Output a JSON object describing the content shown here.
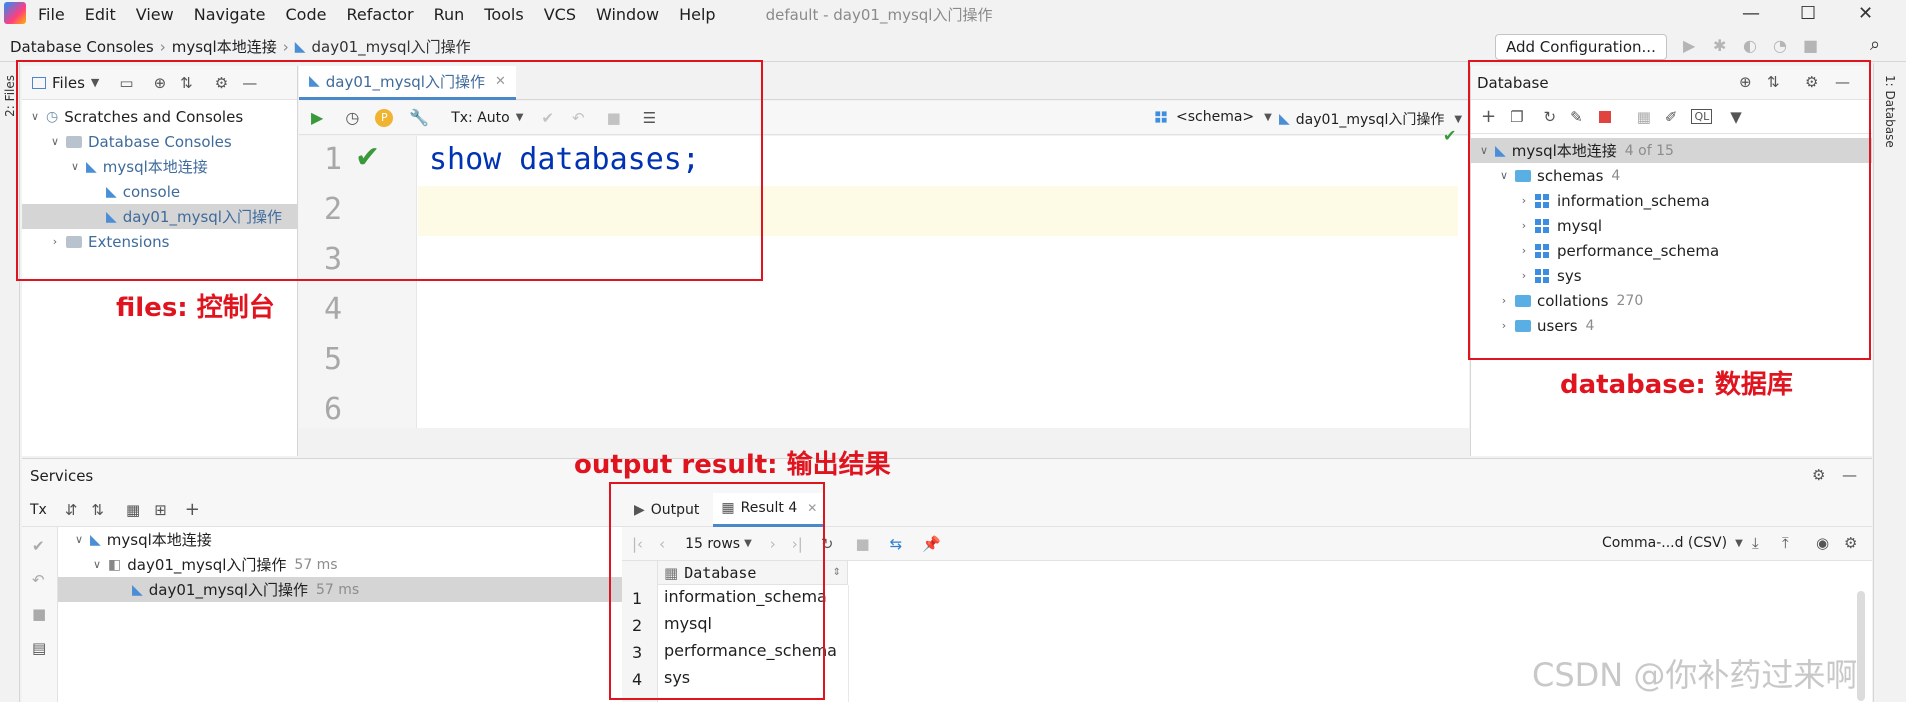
{
  "menu": [
    "File",
    "Edit",
    "View",
    "Navigate",
    "Code",
    "Refactor",
    "Run",
    "Tools",
    "VCS",
    "Window",
    "Help"
  ],
  "window_title": "default - day01_mysql入门操作",
  "breadcrumb": [
    "Database Consoles",
    "mysql本地连接",
    "day01_mysql入门操作"
  ],
  "add_configuration": "Add Configuration...",
  "stripe": {
    "left": "2: Files",
    "right": "1: Database"
  },
  "files": {
    "header": "Files",
    "tree": [
      {
        "label": "Scratches and Consoles"
      },
      {
        "label": "Database Consoles"
      },
      {
        "label": "mysql本地连接"
      },
      {
        "label": "console"
      },
      {
        "label": "day01_mysql入门操作"
      },
      {
        "label": "Extensions"
      }
    ]
  },
  "editor": {
    "tab": "day01_mysql入门操作",
    "tx_mode": "Tx: Auto",
    "schema_selector": "<schema>",
    "session_selector": "day01_mysql入门操作",
    "line_numbers": [
      "1",
      "2",
      "3",
      "4",
      "5",
      "6"
    ],
    "code": "show databases;"
  },
  "database": {
    "header": "Database",
    "connection": "mysql本地连接",
    "connection_count": "4 of 15",
    "schemas_label": "schemas",
    "schemas_count": "4",
    "schemas": [
      "information_schema",
      "mysql",
      "performance_schema",
      "sys"
    ],
    "collations_label": "collations",
    "collations_count": "270",
    "users_label": "users",
    "users_count": "4"
  },
  "services": {
    "header": "Services",
    "tx": "Tx",
    "tree": [
      {
        "label": "mysql本地连接",
        "time": ""
      },
      {
        "label": "day01_mysql入门操作",
        "time": "57 ms"
      },
      {
        "label": "day01_mysql入门操作",
        "time": "57 ms"
      }
    ],
    "tabs": [
      "Output",
      "Result 4"
    ],
    "rows_label": "15 rows",
    "export_format": "Comma-...d (CSV)",
    "column_header": "Database",
    "rows": [
      {
        "n": "1",
        "value": "information_schema"
      },
      {
        "n": "2",
        "value": "mysql"
      },
      {
        "n": "3",
        "value": "performance_schema"
      },
      {
        "n": "4",
        "value": "sys"
      }
    ]
  },
  "annotations": {
    "files": "files: 控制台",
    "database": "database: 数据库",
    "output": "output result: 输出结果"
  },
  "watermark": "CSDN @你补药过来啊"
}
